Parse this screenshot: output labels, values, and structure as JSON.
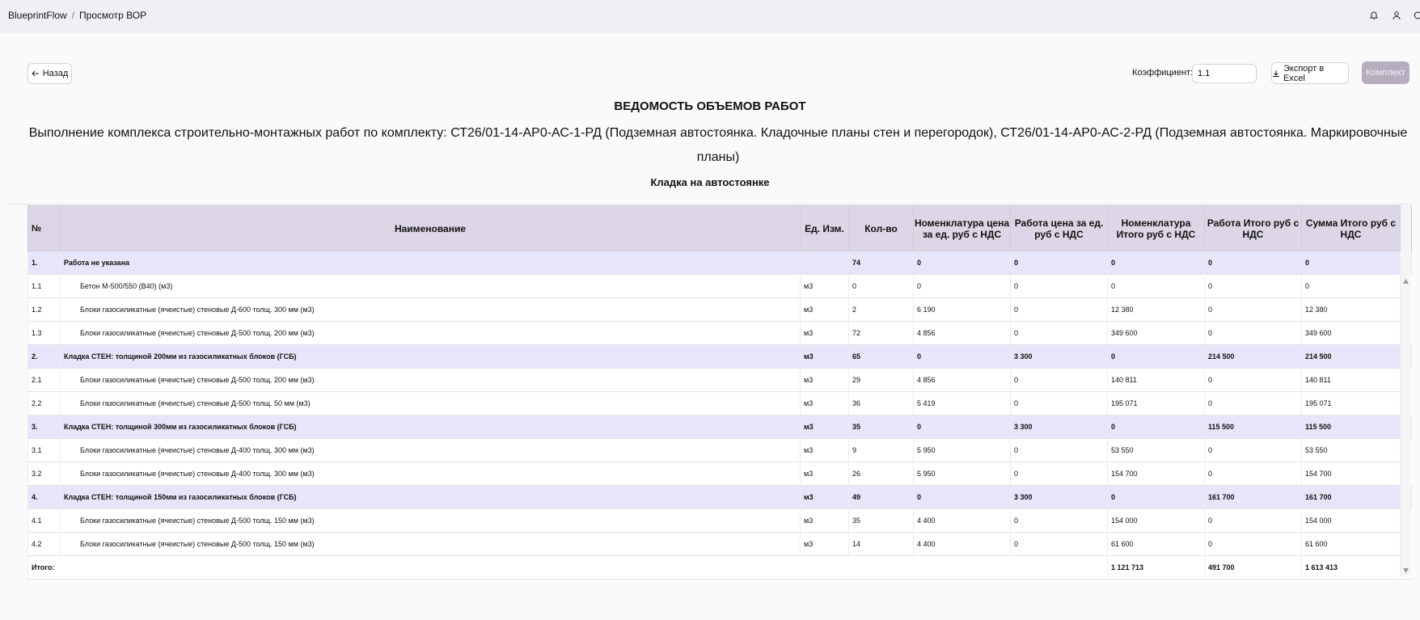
{
  "breadcrumbs": [
    "BlueprintFlow",
    "Просмотр ВОР"
  ],
  "topbar_icons": [
    "bell-icon",
    "user-icon",
    "logout-icon"
  ],
  "back_button": "Назад",
  "coefficient": {
    "label": "Коэффициент:",
    "value": "1.1"
  },
  "export_button": "Экспорт в Excel",
  "komplekt_button": "Комплект",
  "title": "ВЕДОМОСТЬ ОБЪЕМОВ РАБОТ",
  "subtitle": "Выполнение комплекса строительно-монтажных работ по комплекту: СТ26/01-14-АР0-АС-1-РД (Подземная автостоянка. Кладочные планы стен и перегородок), СТ26/01-14-АР0-АС-2-РД (Подземная автостоянка. Маркировочные планы)",
  "section": "Кладка на автостоянке",
  "table": {
    "headers": [
      "№",
      "Наименование",
      "Ед. Изм.",
      "Кол-во",
      "Номенклатура цена за ед. руб с НДС",
      "Работа цена за ед. руб с НДС",
      "Номенклатура Итого руб с НДС",
      "Работа Итого руб с НДС",
      "Сумма Итого руб с НДС"
    ],
    "rows": [
      {
        "type": "group",
        "cells": [
          "1.",
          "Работа не указана",
          "",
          "74",
          "0",
          "0",
          "0",
          "0",
          "0"
        ]
      },
      {
        "type": "item",
        "cells": [
          "1.1",
          "Бетон М-500/550 (В40) (м3)",
          "м3",
          "0",
          "0",
          "0",
          "0",
          "0",
          "0"
        ]
      },
      {
        "type": "item",
        "cells": [
          "1.2",
          "Блоки газосиликатные (ячеистые) стеновые Д-600 толщ. 300 мм (м3)",
          "м3",
          "2",
          "6 190",
          "0",
          "12 380",
          "0",
          "12 380"
        ]
      },
      {
        "type": "item",
        "cells": [
          "1.3",
          "Блоки газосиликатные (ячеистые) стеновые Д-500 толщ. 200 мм (м3)",
          "м3",
          "72",
          "4 856",
          "0",
          "349 600",
          "0",
          "349 600"
        ]
      },
      {
        "type": "group",
        "cells": [
          "2.",
          "Кладка СТЕН: толщиной 200мм из газосиликатных  блоков (ГСБ)",
          "м3",
          "65",
          "0",
          "3 300",
          "0",
          "214 500",
          "214 500"
        ]
      },
      {
        "type": "item",
        "cells": [
          "2.1",
          "Блоки газосиликатные (ячеистые) стеновые Д-500 толщ. 200 мм (м3)",
          "м3",
          "29",
          "4 856",
          "0",
          "140 811",
          "0",
          "140 811"
        ]
      },
      {
        "type": "item",
        "cells": [
          "2.2",
          "Блоки газосиликатные (ячеистые) стеновые Д-500 толщ. 50 мм (м3)",
          "м3",
          "36",
          "5 419",
          "0",
          "195 071",
          "0",
          "195 071"
        ]
      },
      {
        "type": "group",
        "cells": [
          "3.",
          "Кладка СТЕН: толщиной 300мм из газосиликатных  блоков (ГСБ)",
          "м3",
          "35",
          "0",
          "3 300",
          "0",
          "115 500",
          "115 500"
        ]
      },
      {
        "type": "item",
        "cells": [
          "3.1",
          "Блоки газосиликатные (ячеистые) стеновые Д-400 толщ. 300 мм (м3)",
          "м3",
          "9",
          "5 950",
          "0",
          "53 550",
          "0",
          "53 550"
        ]
      },
      {
        "type": "item",
        "cells": [
          "3.2",
          "Блоки газосиликатные (ячеистые) стеновые Д-400 толщ. 300 мм (м3)",
          "м3",
          "26",
          "5 950",
          "0",
          "154 700",
          "0",
          "154 700"
        ]
      },
      {
        "type": "group",
        "cells": [
          "4.",
          "Кладка СТЕН: толщиной 150мм из газосиликатных  блоков (ГСБ)",
          "м3",
          "49",
          "0",
          "3 300",
          "0",
          "161 700",
          "161 700"
        ]
      },
      {
        "type": "item",
        "cells": [
          "4.1",
          "Блоки газосиликатные (ячеистые) стеновые Д-500 толщ. 150 мм (м3)",
          "м3",
          "35",
          "4 400",
          "0",
          "154 000",
          "0",
          "154 000"
        ]
      },
      {
        "type": "item",
        "cells": [
          "4.2",
          "Блоки газосиликатные (ячеистые) стеновые Д-500 толщ. 150 мм (м3)",
          "м3",
          "14",
          "4 400",
          "0",
          "61 600",
          "0",
          "61 600"
        ]
      }
    ],
    "total": {
      "label": "Итого:",
      "nomenclature_total": "1 121 713",
      "work_total": "491 700",
      "sum_total": "1 613 413"
    }
  },
  "colors": {
    "topbar": "#f1eff5",
    "header_bg": "#dcd6e6",
    "group_row_bg": "#e7e5f9",
    "komplekt_button": "#b6aebe"
  }
}
